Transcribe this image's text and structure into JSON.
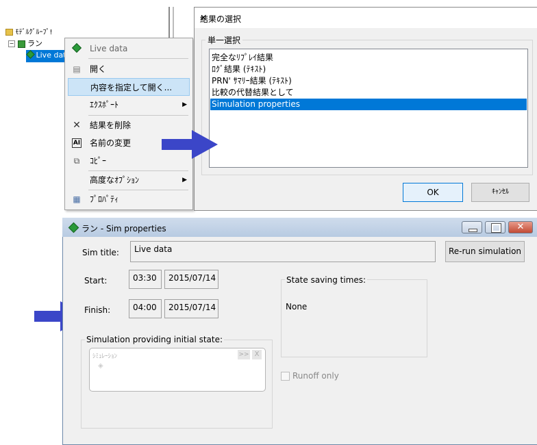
{
  "tree": {
    "root_label": "ﾓﾃﾞﾙｸﾞﾙｰﾌﾟ!",
    "run_label": "ラン",
    "live_label": "Live dat"
  },
  "context_menu": {
    "header": "Live data",
    "items": [
      {
        "label": "開く"
      },
      {
        "label": "内容を指定して開く..."
      },
      {
        "label": "ｴｸｽﾎﾟｰﾄ"
      },
      {
        "label": "結果を削除"
      },
      {
        "label": "名前の変更"
      },
      {
        "label": "ｺﾋﾟｰ"
      },
      {
        "label": "高度なｵﾌﾟｼｮﾝ"
      },
      {
        "label": "ﾌﾟﾛﾊﾟﾃｨ"
      }
    ]
  },
  "select_dialog": {
    "title": "結果の選択",
    "close": "✕",
    "group_label": "単一選択",
    "options": [
      "完全なﾘﾌﾟﾚｲ結果",
      "ﾛｸﾞ結果 (ﾃｷｽﾄ)",
      "PRN' ｻﾏﾘｰ結果 (ﾃｷｽﾄ)",
      "比較の代替結果として",
      "Simulation properties"
    ],
    "selected_index": 4,
    "ok_label": "OK",
    "cancel_label": "ｷｬﾝｾﾙ"
  },
  "sim_window": {
    "title": "ラン - Sim properties",
    "sim_title_label": "Sim title:",
    "sim_title_value": "Live data",
    "rerun_label": "Re-run simulation",
    "start_label": "Start:",
    "start_time": "03:30",
    "start_date": "2015/07/14",
    "finish_label": "Finish:",
    "finish_time": "04:00",
    "finish_date": "2015/07/14",
    "state_saving_label": "State saving times:",
    "state_saving_value": "None",
    "initial_state_label": "Simulation providing initial state:",
    "sim_placeholder": "ｼﾐｭﾚｰｼｮﾝ",
    "sim_nav": ">>",
    "sim_clear": "X",
    "runoff_label": "Runoff only"
  },
  "colors": {
    "accent": "#0078d7",
    "arrow": "#3b46c8",
    "menu_highlight": "#cce4f7"
  }
}
